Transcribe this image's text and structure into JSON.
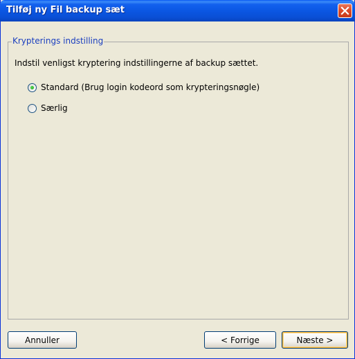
{
  "window": {
    "title": "Tilføj ny Fil backup sæt",
    "close_icon": "close-icon"
  },
  "encryption_group": {
    "label": "Krypterings indstilling",
    "instruction": "Indstil venligst kryptering indstillingerne af backup sættet.",
    "options": [
      {
        "label": "Standard (Brug login kodeord som krypteringsnøgle)",
        "selected": true
      },
      {
        "label": "Særlig",
        "selected": false
      }
    ]
  },
  "footer": {
    "cancel_label": "Annuller",
    "back_label": "< Forrige",
    "next_label": "Næste >"
  },
  "colors": {
    "title_bar": "#0A4FD6",
    "group_label": "#1B3FBF",
    "default_button_focus": "#F8B636",
    "background": "#ECE9D8"
  }
}
